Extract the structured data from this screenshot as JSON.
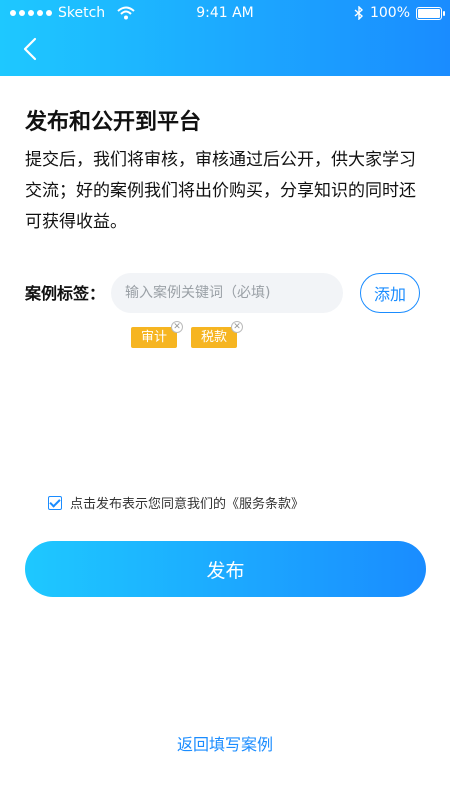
{
  "status_bar": {
    "carrier": "Sketch",
    "time": "9:41 AM",
    "battery": "100%"
  },
  "header": {
    "back_icon": "chevron-left-icon"
  },
  "page": {
    "title": "发布和公开到平台",
    "description": "提交后，我们将审核，审核通过后公开，供大家学习交流；好的案例我们将出价购买，分享知识的同时还可获得收益。"
  },
  "tags_section": {
    "label": "案例标签：",
    "input_placeholder": "输入案例关键词（必填)",
    "add_button": "添加",
    "tags": [
      "审计",
      "税款"
    ]
  },
  "agreement": {
    "text": "点击发布表示您同意我们的《服务条款》",
    "checked": true
  },
  "actions": {
    "publish": "发布",
    "return_link": "返回填写案例"
  },
  "colors": {
    "primary": "#1A8CFF",
    "gradient_start": "#1EC8FF",
    "tag_bg": "#F6B521"
  }
}
